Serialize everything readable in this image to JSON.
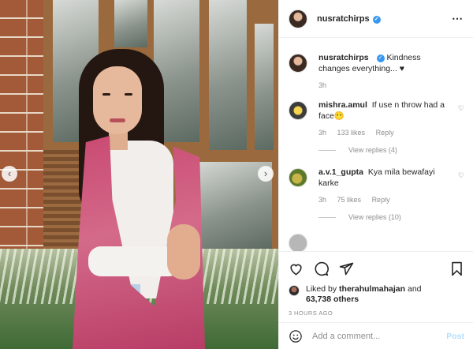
{
  "post": {
    "author": "nusratchirps",
    "verified_badge": "✓",
    "more_icon": "⋯"
  },
  "caption": {
    "username": "nusratchirps",
    "text": "Kindness changes everything...",
    "heart": "♥",
    "time": "3h"
  },
  "comments": [
    {
      "username": "mishra.amul",
      "text": "If use n throw had a face😶",
      "time": "3h",
      "likes": "133 likes",
      "reply": "Reply",
      "view_replies": "View replies (4)"
    },
    {
      "username": "a.v.1_gupta",
      "text": "Kya mila bewafayi karke",
      "time": "3h",
      "likes": "75 likes",
      "reply": "Reply",
      "view_replies": "View replies (10)"
    }
  ],
  "likes": {
    "prefix": "Liked by",
    "user": "therahulmahajan",
    "conjunction": "and",
    "others": "63,738 others"
  },
  "timestamp": "3 HOURS AGO",
  "add_comment": {
    "placeholder": "Add a comment...",
    "post_label": "Post"
  },
  "icons": {
    "prev": "‹",
    "next": "›",
    "comment_like": "♡"
  },
  "colors": {
    "verified": "#3897f0",
    "post_button": "#b2dffc",
    "secondary_text": "#8e8e8e"
  }
}
